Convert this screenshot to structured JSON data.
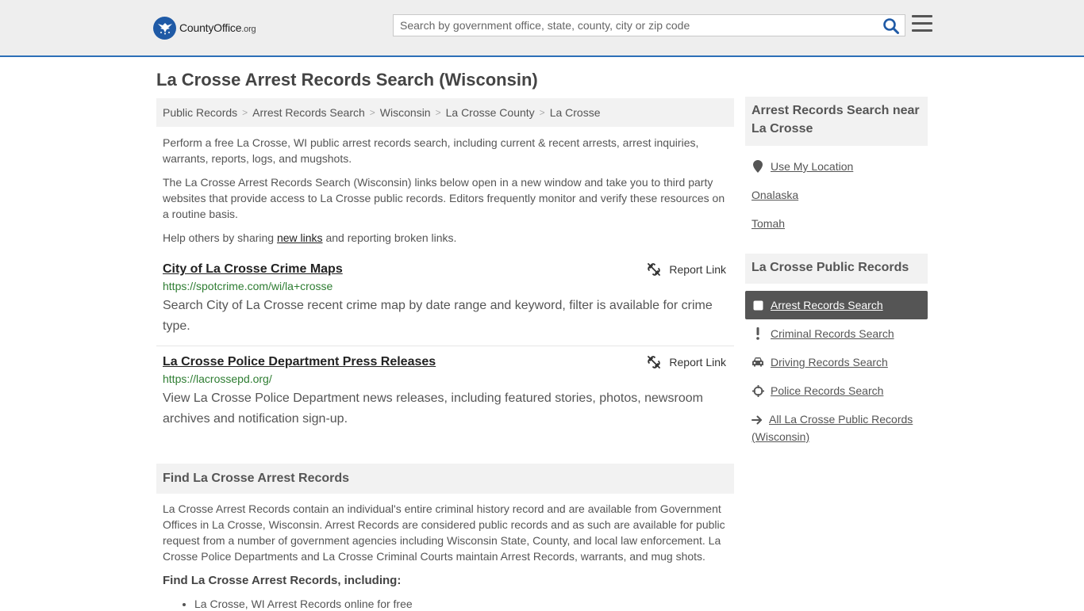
{
  "header": {
    "logo_name": "County",
    "logo_name2": "Office",
    "logo_tld": ".org",
    "search_placeholder": "Search by government office, state, county, city or zip code"
  },
  "page": {
    "title": "La Crosse Arrest Records Search (Wisconsin)"
  },
  "breadcrumb": [
    "Public Records",
    "Arrest Records Search",
    "Wisconsin",
    "La Crosse County",
    "La Crosse"
  ],
  "intro": {
    "p1": "Perform a free La Crosse, WI public arrest records search, including current & recent arrests, arrest inquiries, warrants, reports, logs, and mugshots.",
    "p2": "The La Crosse Arrest Records Search (Wisconsin) links below open in a new window and take you to third party websites that provide access to La Crosse public records. Editors frequently monitor and verify these resources on a routine basis.",
    "p3_before": "Help others by sharing ",
    "p3_link": "new links",
    "p3_after": " and reporting broken links."
  },
  "listings": [
    {
      "title": "City of La Crosse Crime Maps",
      "url": "https://spotcrime.com/wi/la+crosse",
      "description": "Search City of La Crosse recent crime map by date range and keyword, filter is available for crime type.",
      "report_label": "Report Link"
    },
    {
      "title": "La Crosse Police Department Press Releases",
      "url": "https://lacrossepd.org/",
      "description": "View La Crosse Police Department news releases, including featured stories, photos, newsroom archives and notification sign-up.",
      "report_label": "Report Link"
    }
  ],
  "find_section": {
    "heading": "Find La Crosse Arrest Records",
    "body": "La Crosse Arrest Records contain an individual's entire criminal history record and are available from Government Offices in La Crosse, Wisconsin. Arrest Records are considered public records and as such are available for public request from a number of government agencies including Wisconsin State, County, and local law enforcement. La Crosse Police Departments and La Crosse Criminal Courts maintain Arrest Records, warrants, and mug shots.",
    "subheading": "Find La Crosse Arrest Records, including:",
    "bullets": [
      "La Crosse, WI Arrest Records online for free"
    ]
  },
  "sidebar": {
    "near_heading": "Arrest Records Search near La Crosse",
    "use_location": "Use My Location",
    "nearby": [
      "Onalaska",
      "Tomah"
    ],
    "public_heading": "La Crosse Public Records",
    "public_items": [
      {
        "label": "Arrest Records Search",
        "icon": "square-icon",
        "active": true
      },
      {
        "label": "Criminal Records Search",
        "icon": "exclamation-icon",
        "active": false
      },
      {
        "label": "Driving Records Search",
        "icon": "car-icon",
        "active": false
      },
      {
        "label": "Police Records Search",
        "icon": "crosshair-icon",
        "active": false
      }
    ],
    "all_records": "All La Crosse Public Records (Wisconsin)"
  },
  "colors": {
    "accent": "#2c6fb7",
    "url_green": "#2e7d32",
    "active_bg": "#555555",
    "panel_bg": "#f2f2f2"
  }
}
